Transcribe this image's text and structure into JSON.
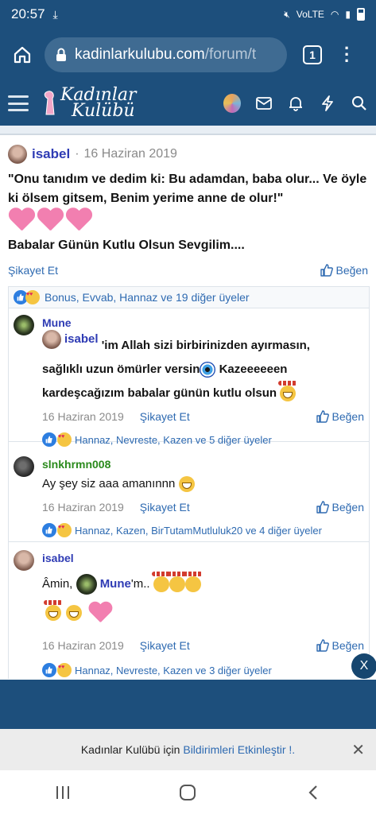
{
  "status": {
    "time": "20:57",
    "network": "VoLTE",
    "icons": [
      "download-icon",
      "mute-icon",
      "wifi-icon",
      "signal-icon",
      "battery-icon"
    ]
  },
  "browser": {
    "url_host": "kadinlarkulubu.com",
    "url_path": "/forum/t",
    "tab_count": "1"
  },
  "site": {
    "logo_line1": "Kadınlar",
    "logo_line2": "Kulübü"
  },
  "post": {
    "author": "isabel",
    "date": "16 Haziran 2019",
    "quote": "\"Onu tanıdım ve dedim ki: Bu adamdan, baba olur... Ve öyle ki ölsem gitsem, Benim yerime anne de olur!\"",
    "greeting": "Babalar Günün Kutlu Olsun Sevgilim....",
    "report_label": "Şikayet Et",
    "like_label": "Beğen",
    "reactions": "Bonus, Evvab, Hannaz ve 19 diğer üyeler"
  },
  "comments": [
    {
      "author": "Mune",
      "quoted_user": "isabel",
      "text_1": "'im Allah sizi birbirinizden ayırmasın,",
      "text_2": "sağlıklı uzun ömürler versin",
      "text_3": "Kazeeeeeen",
      "text_4": "kardeşcağızım babalar günün kutlu olsun",
      "date": "16 Haziran 2019",
      "report_label": "Şikayet Et",
      "like_label": "Beğen",
      "reactions": "Hannaz, Nevreste, Kazen ve 5 diğer üyeler"
    },
    {
      "author": "slnkhrmn008",
      "text": "Ay şey siz aaa amanınnn",
      "date": "16 Haziran 2019",
      "report_label": "Şikayet Et",
      "like_label": "Beğen",
      "reactions": "Hannaz, Kazen, BirTutamMutluluk20 ve 4 diğer üyeler"
    },
    {
      "author": "isabel",
      "text_prefix": "Âmin,",
      "mention": "Mune",
      "text_suffix": "'m..",
      "date": "16 Haziran 2019",
      "report_label": "Şikayet Et",
      "like_label": "Beğen",
      "reactions": "Hannaz, Nevreste, Kazen ve 3 diğer üyeler"
    }
  ],
  "notify": {
    "prefix": "Kadınlar Kulübü için",
    "link": "Bildirimleri Etkinleştir !.",
    "close": "✕"
  },
  "close_fab": "X"
}
